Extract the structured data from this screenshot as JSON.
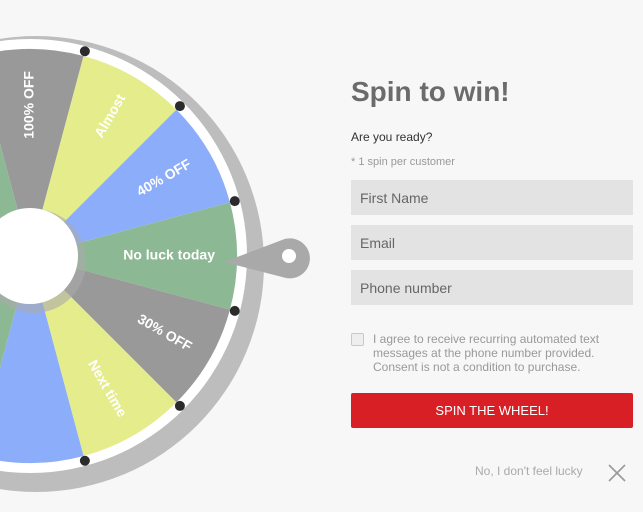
{
  "colors": {
    "accent": "#d91f26",
    "title": "#6b6b6b",
    "field_bg": "#e3e3e3",
    "wheel_gray": "#999999",
    "wheel_yellow": "#e5ec8c",
    "wheel_blue": "#8cadf9",
    "wheel_green": "#8cb994"
  },
  "wheel": {
    "segments": [
      {
        "label": "100% OFF",
        "color": "#999999"
      },
      {
        "label": "Almost",
        "color": "#e5ec8c"
      },
      {
        "label": "40% OFF",
        "color": "#8cadf9"
      },
      {
        "label": "No luck today",
        "color": "#8cb994"
      },
      {
        "label": "30% OFF",
        "color": "#999999"
      },
      {
        "label": "Next time",
        "color": "#e5ec8c"
      },
      {
        "label": "",
        "color": "#8cadf9"
      },
      {
        "label": "",
        "color": "#8cb994"
      },
      {
        "label": "",
        "color": "#999999"
      },
      {
        "label": "",
        "color": "#e5ec8c"
      },
      {
        "label": "",
        "color": "#8cadf9"
      },
      {
        "label": "",
        "color": "#8cb994"
      }
    ]
  },
  "title": "Spin to win!",
  "subtitle": "Are you ready?",
  "note": "* 1 spin per customer",
  "fields": {
    "first_name": {
      "placeholder": "First Name",
      "value": ""
    },
    "email": {
      "placeholder": "Email",
      "value": ""
    },
    "phone": {
      "placeholder": "Phone number",
      "value": ""
    }
  },
  "consent": {
    "checked": false,
    "text": "I agree to receive recurring automated text messages at the phone number provided. Consent is not a condition to purchase."
  },
  "spin_button": "SPIN THE WHEEL!",
  "no_luck_link": "No, I don't feel lucky",
  "close_icon": "close-icon"
}
